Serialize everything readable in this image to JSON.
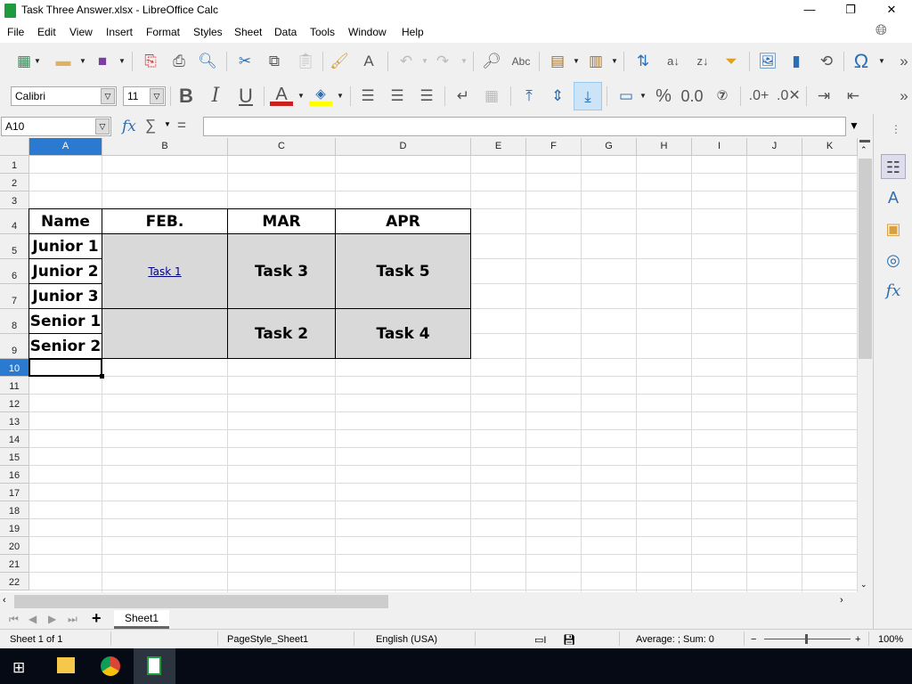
{
  "window": {
    "title": "Task Three Answer.xlsx - LibreOffice Calc"
  },
  "menu": [
    "File",
    "Edit",
    "View",
    "Insert",
    "Format",
    "Styles",
    "Sheet",
    "Data",
    "Tools",
    "Window",
    "Help"
  ],
  "toolbar": {
    "font_name": "Calibri",
    "font_size": "11"
  },
  "formula_bar": {
    "cell_ref": "A10",
    "content": "",
    "fx": "fx",
    "sum": "∑",
    "equals": "="
  },
  "columns": [
    "A",
    "B",
    "C",
    "D",
    "E",
    "F",
    "G",
    "H",
    "I",
    "J",
    "K"
  ],
  "rows": [
    "1",
    "2",
    "3",
    "4",
    "5",
    "6",
    "7",
    "8",
    "9",
    "10",
    "11",
    "12",
    "13",
    "14",
    "15",
    "16",
    "17",
    "18",
    "19",
    "20",
    "21",
    "22"
  ],
  "selected_cell": "A10",
  "cells": {
    "A4": "Name",
    "B4": "FEB.",
    "C4": "MAR",
    "D4": "APR",
    "A5": "Junior 1",
    "A6": "Junior 2",
    "A7": "Junior 3",
    "A8": "Senior 1",
    "A9": "Senior 2",
    "B5": "Task 1",
    "B8": "",
    "C5": "Task 3",
    "D5": "Task 5",
    "C8": "Task 2",
    "D8": "Task 4"
  },
  "sheet_tabs": [
    "Sheet1"
  ],
  "status": {
    "sheet": "Sheet 1 of 1",
    "page_style": "PageStyle_Sheet1",
    "language": "English (USA)",
    "summary": "Average: ; Sum: 0",
    "zoom": "100%"
  },
  "colors": {
    "selection": "#2a7ad2",
    "cell_fill": "#d9d9d9",
    "link": "#000080"
  }
}
